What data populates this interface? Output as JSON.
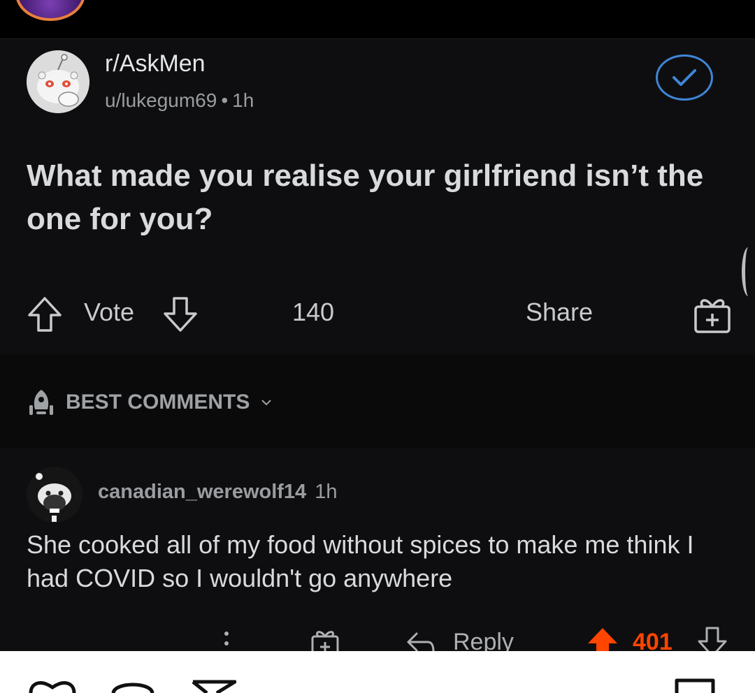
{
  "post": {
    "subreddit": "r/AskMen",
    "author": "u/lukegum69",
    "separator": "•",
    "age": "1h",
    "title": "What made you realise your girlfriend isn’t the one for you?",
    "vote_label": "Vote",
    "comment_count": "140",
    "share_label": "Share"
  },
  "sort": {
    "label": "BEST COMMENTS"
  },
  "comment": {
    "username": "canadian_werewolf14",
    "age": "1h",
    "body": "She cooked all of my food without spices to make me think I had COVID so I wouldn't go anywhere",
    "reply_label": "Reply",
    "score": "401"
  },
  "colors": {
    "background": "#0e0e10",
    "upvote_active": "#ff4500",
    "joined_badge": "#3f86d6",
    "text_primary": "#d8dadc",
    "text_muted": "#9a9da0"
  },
  "icons": {
    "upvote": "arrow-up-outline-icon",
    "downvote": "arrow-down-outline-icon",
    "award": "gift-icon",
    "reply": "reply-arrow-icon",
    "more": "vertical-dots-icon",
    "sort": "rocket-icon"
  }
}
